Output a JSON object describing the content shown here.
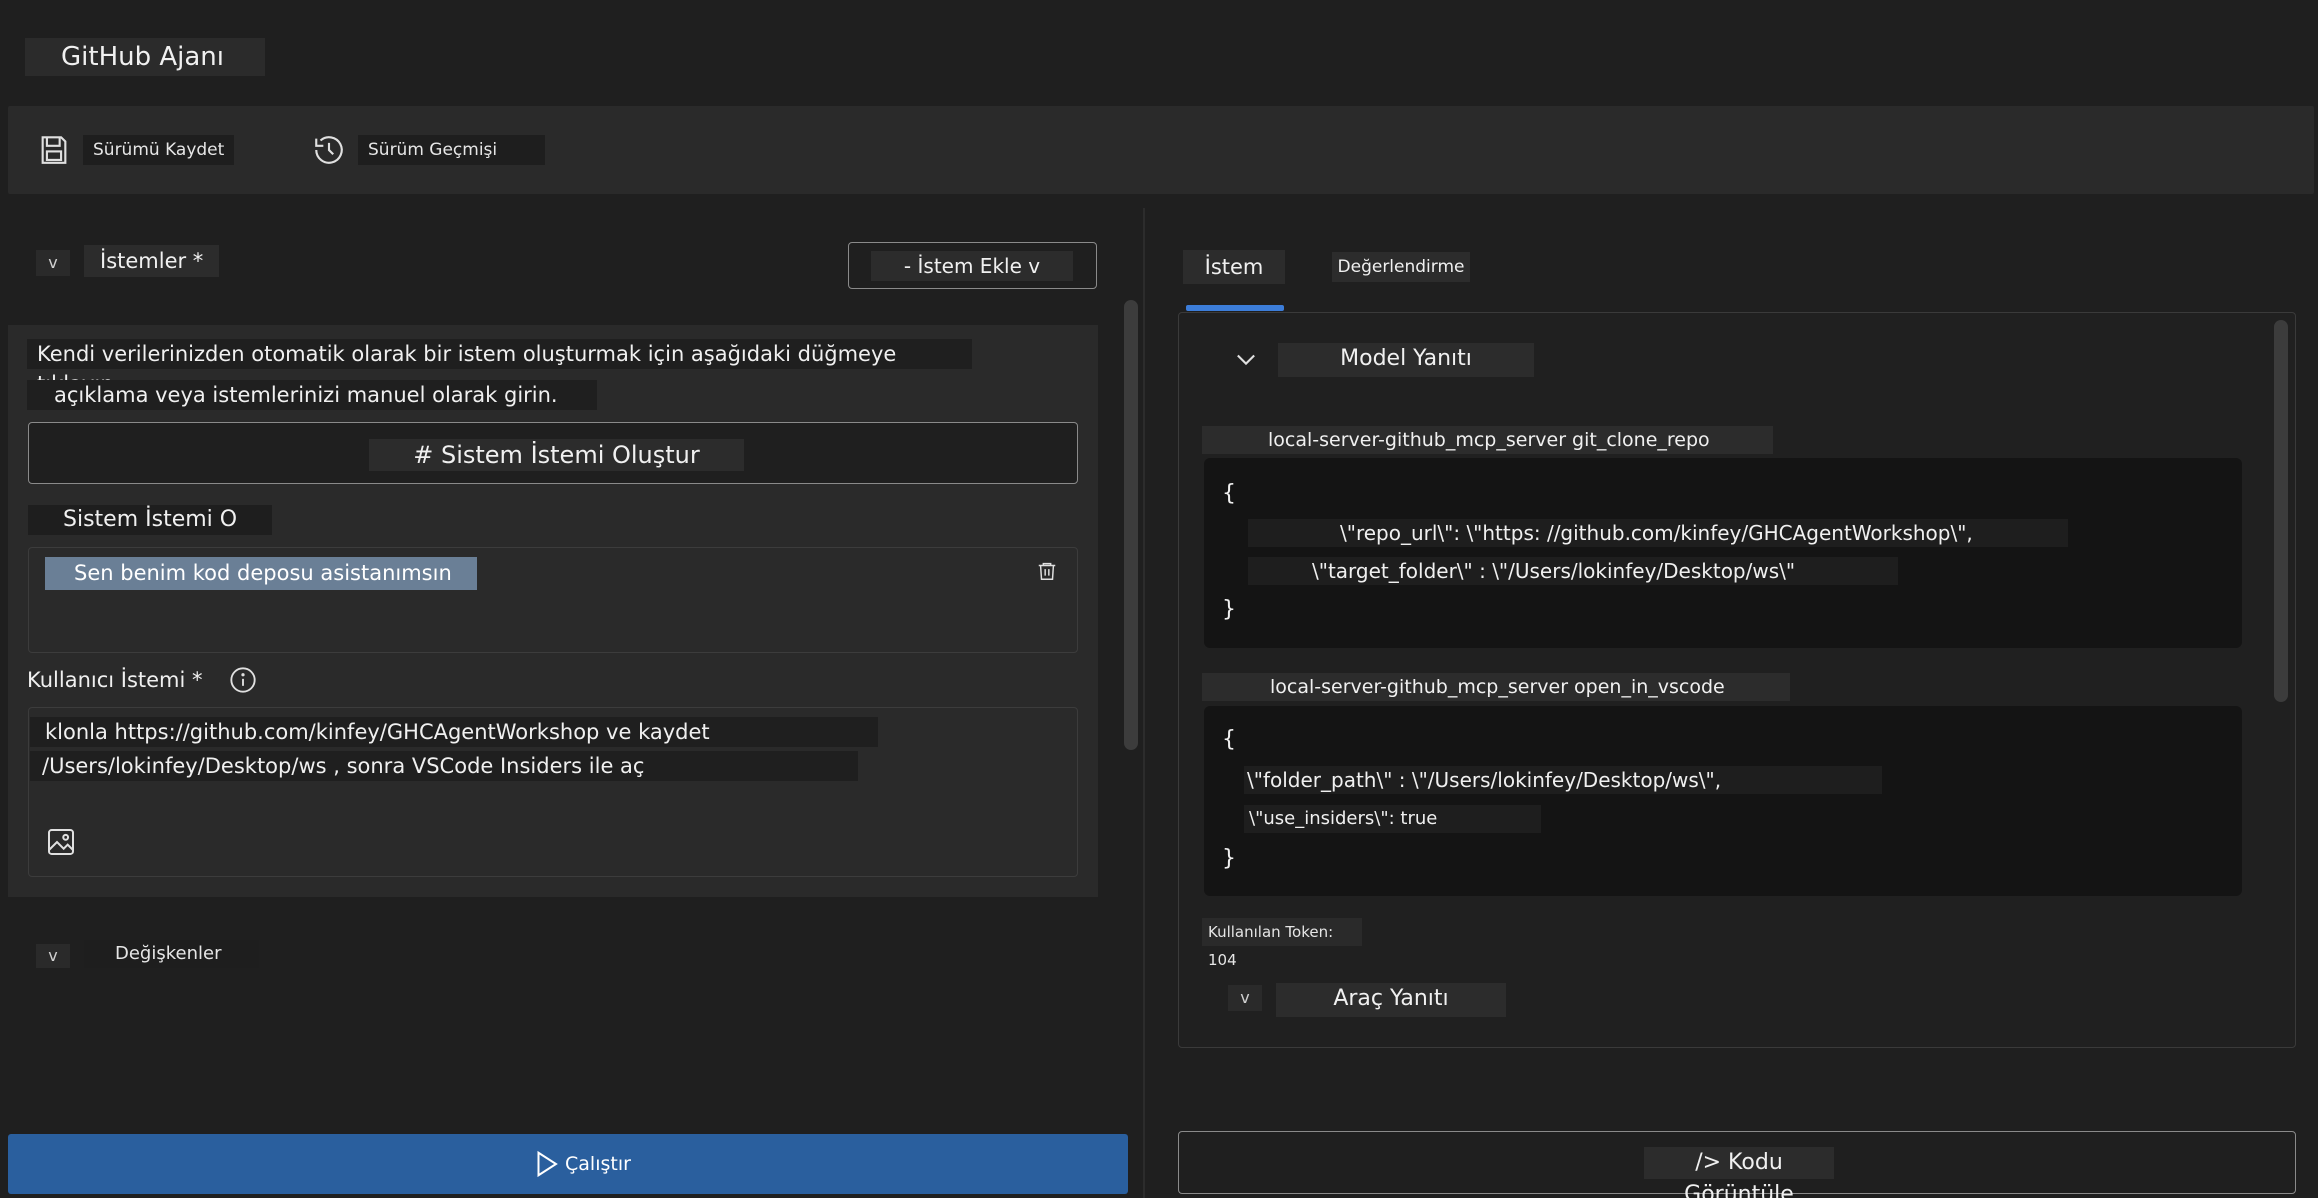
{
  "app": {
    "title": "GitHub Ajanı"
  },
  "toolbar": {
    "save_label": "Sürümü Kaydet",
    "history_label": "Sürüm Geçmişi"
  },
  "left": {
    "collapse_glyph": "v",
    "prompts_title": "İstemler *",
    "add_prompt_label": "- İstem Ekle v",
    "description_line1": "Kendi verilerinizden otomatik olarak bir istem oluşturmak için aşağıdaki düğmeye tıklayın",
    "description_line2": "açıklama veya istemlerinizi manuel olarak girin.",
    "generate_label": "# Sistem İstemi Oluştur",
    "system_prompt_label": "Sistem İstemi O",
    "system_prompt_value": "Sen benim kod deposu asistanımsın",
    "user_prompt_label": "Kullanıcı İstemi *",
    "user_prompt_line1": "klonla https://github.com/kinfey/GHCAgentWorkshop ve kaydet",
    "user_prompt_line2": "/Users/lokinfey/Desktop/ws , sonra VSCode Insiders ile aç",
    "variables_label": "Değişkenler",
    "run_label": "Çalıştır"
  },
  "right": {
    "tabs": [
      {
        "label": "İstem",
        "active": true
      },
      {
        "label": "Değerlendirme",
        "active": false
      }
    ],
    "model_response_title": "Model Yanıtı",
    "tool_calls": [
      {
        "name": "local-server-github_mcp_server git_clone_repo",
        "open_brace": "{",
        "lines": [
          "\\\"repo_url\\\": \\\"https: //github.com/kinfey/GHCAgentWorkshop\\\",",
          "\\\"target_folder\\\" : \\\"/Users/lokinfey/Desktop/ws\\\""
        ],
        "close_brace": "}"
      },
      {
        "name": "local-server-github_mcp_server open_in_vscode",
        "open_brace": "{",
        "lines": [
          "\\\"folder_path\\\" : \\\"/Users/lokinfey/Desktop/ws\\\",",
          "\\\"use_insiders\\\": true"
        ],
        "close_brace": "}"
      }
    ],
    "tokens_label": "Kullanılan Token: 104",
    "tool_response_glyph": "v",
    "tool_response_title": "Araç Yanıtı",
    "view_code_label": "/> Kodu Görüntüle"
  },
  "colors": {
    "accent": "#3c7dd9",
    "run_button": "#2a5f9e",
    "selection": "#6a7f96"
  }
}
